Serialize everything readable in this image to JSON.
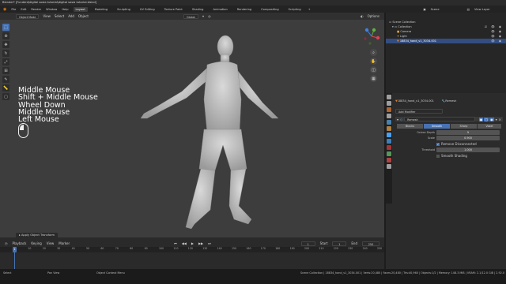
{
  "window": {
    "title": "Blender* [Funderd\\digital sosia tutorial\\digital sosia tutorial.blend]"
  },
  "menu": {
    "items": [
      "File",
      "Edit",
      "Render",
      "Window",
      "Help"
    ]
  },
  "workspaces": [
    "Layout",
    "Modeling",
    "Sculpting",
    "UV Editing",
    "Texture Paint",
    "Shading",
    "Animation",
    "Rendering",
    "Compositing",
    "Scripting"
  ],
  "top_right": {
    "scene": "Scene",
    "view_layer": "View Layer"
  },
  "viewport": {
    "mode": "Object Mode",
    "menus": [
      "View",
      "Select",
      "Add",
      "Object"
    ],
    "orientation": "Global",
    "options_label": "Options",
    "key_overlay": [
      "Middle Mouse",
      "Shift + Middle Mouse",
      "Wheel Down",
      "Middle Mouse",
      "Left Mouse"
    ],
    "operator_panel": "Apply Object Transform"
  },
  "timeline": {
    "menus": [
      "Playback",
      "Keying",
      "View",
      "Marker"
    ],
    "current_frame": "1",
    "start_label": "Start",
    "start": "1",
    "end_label": "End",
    "end": "250",
    "ticks": [
      "0",
      "10",
      "20",
      "30",
      "40",
      "50",
      "60",
      "70",
      "80",
      "90",
      "100",
      "110",
      "120",
      "130",
      "140",
      "150",
      "160",
      "170",
      "180",
      "190",
      "200",
      "210",
      "220",
      "230",
      "240",
      "250"
    ]
  },
  "status": {
    "select": "Select",
    "pan_view": "Pan View",
    "context_menu": "Object Context Menu",
    "info": "Scene Collection | 18834_hand_v1_3034.001 | Verts:20,480 | Faces:20,480 | Tris:40,960 | Objects:1/2 | Memory: 148.3 MiB | VRAM: 2.1/12.0 GiB | 2.92.0"
  },
  "outliner": {
    "rows": [
      {
        "label": "Scene Collection",
        "selected": false
      },
      {
        "label": "Collection",
        "selected": false
      },
      {
        "label": "Camera",
        "selected": false
      },
      {
        "label": "Light",
        "selected": false
      },
      {
        "label": "18834_hand_v1_3034.001",
        "selected": true
      }
    ]
  },
  "properties": {
    "object_name": "18834_hand_v1_3034.001",
    "datablock_name": "Remesh",
    "add_modifier": "Add Modifier",
    "modifier_name": "Remesh",
    "modes": [
      "Blocks",
      "Smooth",
      "Sharp",
      "Voxel"
    ],
    "active_mode": "Smooth",
    "fields": {
      "octree_depth_label": "Octree Depth",
      "octree_depth": "9",
      "scale_label": "Scale",
      "scale": "0.900",
      "remove_disconnected": "Remove Disconnected",
      "threshold_label": "Threshold",
      "threshold": "1.000",
      "smooth_shading": "Smooth Shading"
    },
    "tab_colors": [
      "#c9c9c9",
      "#c9c9c9",
      "#e07e3c",
      "#c9c9c9",
      "#5aa3e0",
      "#e0a24c",
      "#4aa0f0",
      "#4aa0f0",
      "#d04040",
      "#6cc070",
      "#e05050",
      "#c9c9c9"
    ]
  }
}
